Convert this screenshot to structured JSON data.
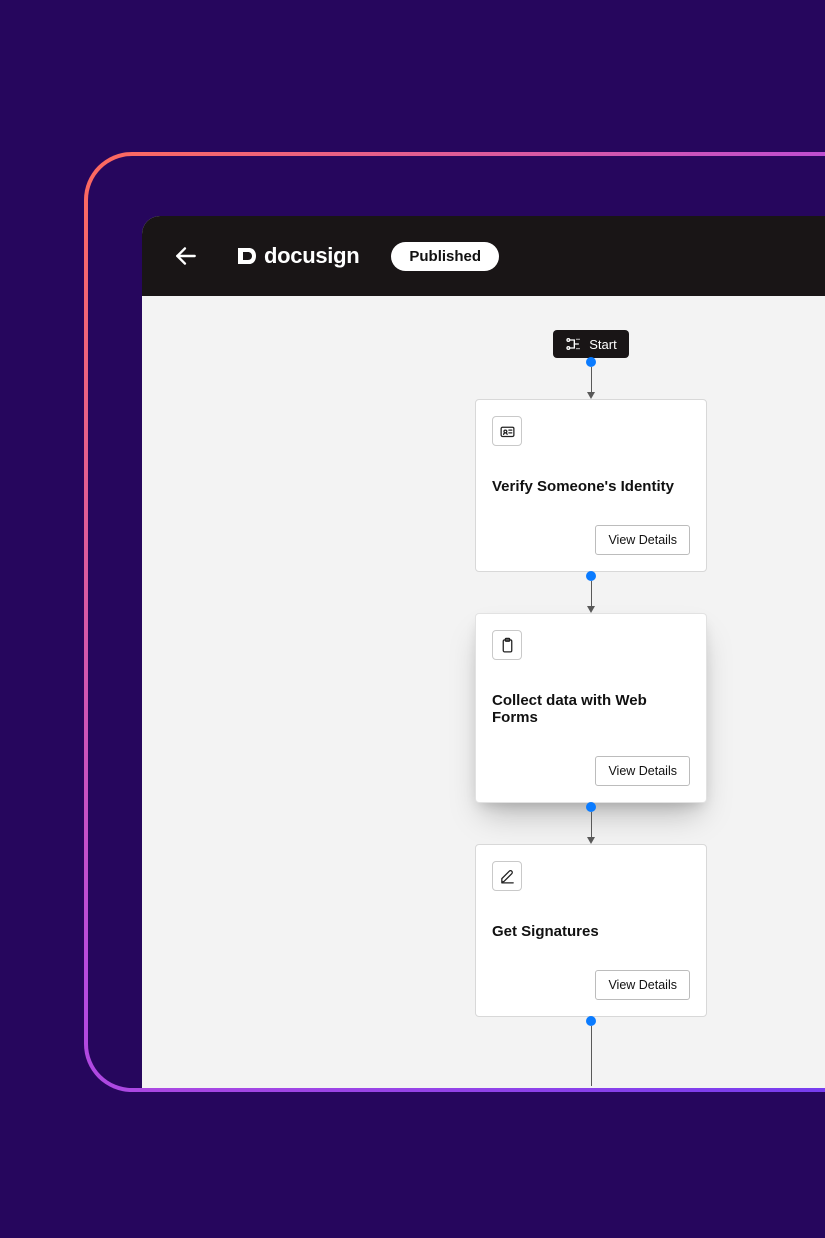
{
  "header": {
    "brand": "docusign",
    "status": "Published"
  },
  "workflow": {
    "start_label": "Start",
    "view_details_label": "View Details",
    "steps": [
      {
        "title": "Verify Someone's Identity",
        "icon": "id-card-icon",
        "active": false
      },
      {
        "title": "Collect data with Web Forms",
        "icon": "clipboard-icon",
        "active": true
      },
      {
        "title": "Get Signatures",
        "icon": "pen-icon",
        "active": false
      }
    ]
  }
}
